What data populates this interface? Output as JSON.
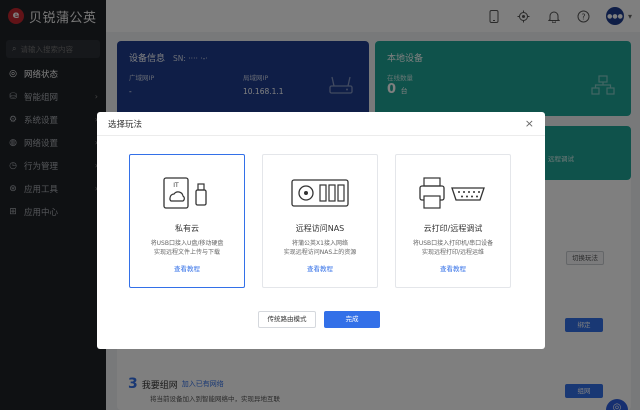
{
  "app": {
    "logo_text": "贝锐蒲公英",
    "logo_mark": "e"
  },
  "sidebar": {
    "search_placeholder": "请输入搜索内容",
    "items": [
      {
        "label": "网络状态",
        "icon": "globe-icon",
        "glyph": "◎",
        "active": true,
        "chevron": ""
      },
      {
        "label": "智能组网",
        "icon": "network-icon",
        "glyph": "⛁",
        "active": false,
        "chevron": "›"
      },
      {
        "label": "系统设置",
        "icon": "gear-icon",
        "glyph": "⚙",
        "active": false,
        "chevron": "›"
      },
      {
        "label": "网络设置",
        "icon": "globe-settings-icon",
        "glyph": "◍",
        "active": false,
        "chevron": "›"
      },
      {
        "label": "行为管理",
        "icon": "behavior-icon",
        "glyph": "◷",
        "active": false,
        "chevron": "›"
      },
      {
        "label": "应用工具",
        "icon": "tools-icon",
        "glyph": "⊛",
        "active": false,
        "chevron": "›"
      },
      {
        "label": "应用中心",
        "icon": "app-center-icon",
        "glyph": "⊞",
        "active": false,
        "chevron": ""
      }
    ]
  },
  "topbar": {
    "avatar_text": "●●●"
  },
  "cards": {
    "device": {
      "title": "设备信息",
      "sn": "SN: ···· ·-·",
      "wan_label": "广域网IP",
      "wan_value": "-",
      "lan_label": "局域网IP",
      "lan_value": "10.168.1.1"
    },
    "local": {
      "title": "本地设备",
      "online_label": "在线数量",
      "online_value": "0",
      "online_unit": "台"
    },
    "strip_text": "远程调试"
  },
  "background": {
    "switch_label": "切换玩法",
    "bind_label": "绑定",
    "mesh_num": "3",
    "mesh_title": "我要组网",
    "mesh_link": "加入已有网络",
    "mesh_desc": "将当前设备加入到智能网络中，实现异地互联",
    "net_label": "组网"
  },
  "modal": {
    "title": "选择玩法",
    "close": "×",
    "options": [
      {
        "title": "私有云",
        "desc1": "将USB口接入U盘/移动硬盘",
        "desc2": "实现远程文件上传与下载",
        "link": "查看教程",
        "icon": "private-cloud-icon",
        "selected": true
      },
      {
        "title": "远程访问NAS",
        "desc1": "将蒲公英X1接入网络",
        "desc2": "实现远程访问NAS上的资源",
        "link": "查看教程",
        "icon": "nas-icon",
        "selected": false
      },
      {
        "title": "云打印/远程调试",
        "desc1": "将USB口接入打印机/串口设备",
        "desc2": "实现远程打印/远程运维",
        "link": "查看教程",
        "icon": "printer-serial-icon",
        "selected": false
      }
    ],
    "legacy_button": "传统路由模式",
    "done_button": "完成"
  },
  "colors": {
    "brand_blue": "#1e3d8f",
    "teal": "#1fa597",
    "accent": "#3370e8",
    "sidebar_bg": "#1f2227"
  }
}
